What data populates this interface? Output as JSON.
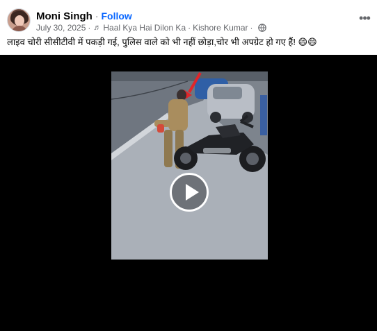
{
  "author": {
    "name": "Moni Singh",
    "separator": "·",
    "follow_label": "Follow"
  },
  "meta": {
    "date": "July 30, 2025",
    "separator": "·",
    "music_icon": "music-note-icon",
    "song": "Haal Kya Hai Dilon Ka",
    "artist": "Kishore Kumar",
    "audience_icon": "globe-icon"
  },
  "more_icon": "more-options-icon",
  "post": {
    "caption": "लाइव चोरी सीसीटीवी में पकड़ी गई, पुलिस वाले को भी नहीं छोड़ा,चोर भी अपग्रेट हो गए हैं! 😄😄"
  },
  "video": {
    "play_icon": "play-icon"
  },
  "colors": {
    "link": "#0866ff",
    "muted_text": "#65676b",
    "video_bg": "#000000"
  }
}
